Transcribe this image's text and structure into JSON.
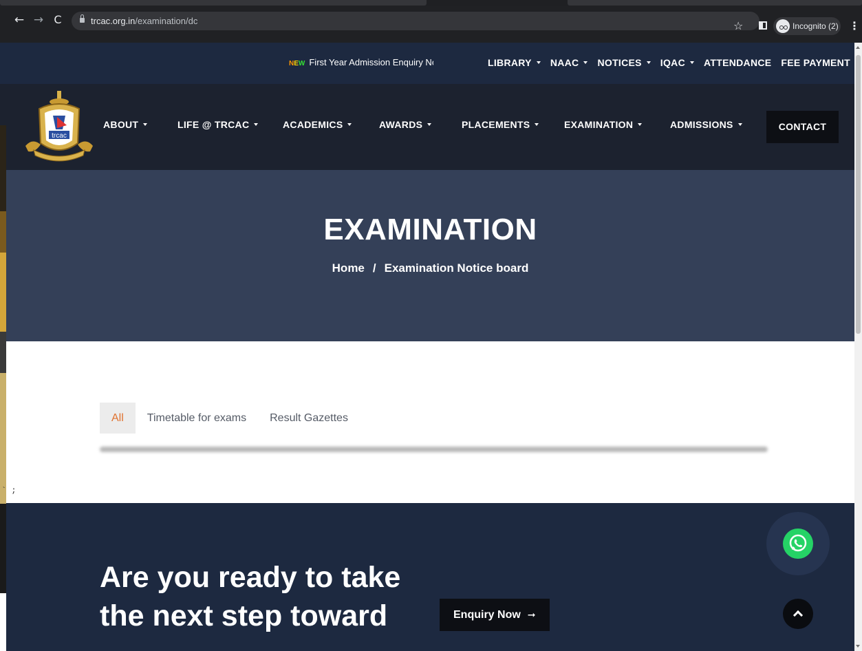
{
  "browser": {
    "url_host": "trcac.org.in",
    "url_path": "/examination/dc",
    "profile_label": "Incognito (2)",
    "icons": [
      "back-arrow-icon",
      "forward-arrow-icon",
      "reload-icon",
      "lock-icon",
      "star-icon",
      "side-panel-icon",
      "incognito-icon",
      "kebab-menu-icon"
    ]
  },
  "topbar": {
    "new_badge": "NEW",
    "ticker_text": "First Year Admission Enquiry Now",
    "links": [
      {
        "label": "LIBRARY",
        "has_dropdown": true
      },
      {
        "label": "NAAC",
        "has_dropdown": true
      },
      {
        "label": "NOTICES",
        "has_dropdown": true
      },
      {
        "label": "IQAC",
        "has_dropdown": true
      },
      {
        "label": "ATTENDANCE",
        "has_dropdown": false
      },
      {
        "label": "FEE PAYMENT",
        "has_dropdown": false
      }
    ]
  },
  "mainnav": {
    "logo_text": "trcac",
    "items": [
      {
        "label": "ABOUT"
      },
      {
        "label": "LIFE @ TRCAC"
      },
      {
        "label": "ACADEMICS"
      },
      {
        "label": "AWARDS"
      },
      {
        "label": "PLACEMENTS"
      },
      {
        "label": "EXAMINATION"
      },
      {
        "label": "ADMISSIONS"
      }
    ],
    "contact_label": "CONTACT"
  },
  "hero": {
    "title": "EXAMINATION",
    "breadcrumb_home": "Home",
    "breadcrumb_sep": "/",
    "breadcrumb_current": "Examination Notice board"
  },
  "filters": [
    {
      "label": "All",
      "active": true
    },
    {
      "label": "Timetable for exams",
      "active": false
    },
    {
      "label": "Result Gazettes",
      "active": false
    }
  ],
  "cta": {
    "title": "Are you ready to take the next step toward",
    "button_label": "Enquiry Now"
  },
  "colors": {
    "topbar_bg": "#1d2940",
    "nav_bg": "#1c222f",
    "hero_bg": "#344058",
    "active_filter": "#e0722f",
    "whatsapp": "#25d366"
  }
}
